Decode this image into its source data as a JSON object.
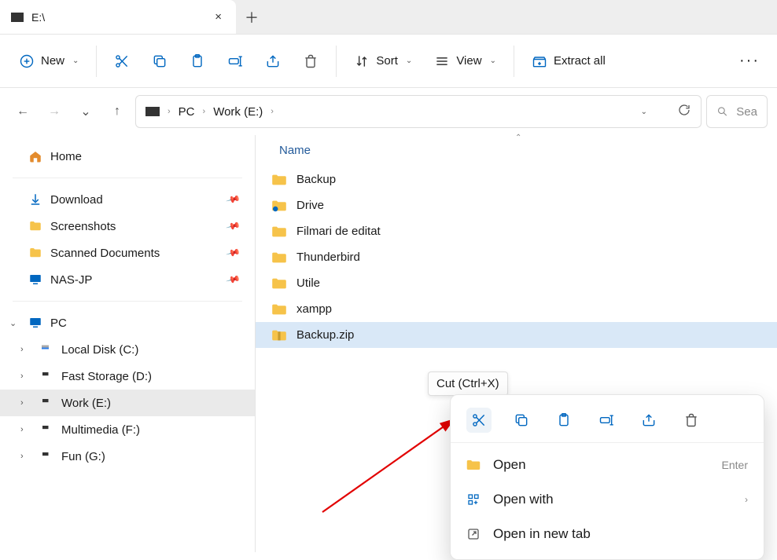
{
  "tab": {
    "title": "E:\\",
    "close": "×",
    "add": "＋"
  },
  "toolbar": {
    "new": "New",
    "sort": "Sort",
    "view": "View",
    "extract": "Extract all"
  },
  "breadcrumb": [
    "PC",
    "Work (E:)"
  ],
  "search": {
    "placeholder": "Sea"
  },
  "nav": {
    "home": "Home",
    "quick": [
      {
        "label": "Download",
        "icon": "download"
      },
      {
        "label": "Screenshots",
        "icon": "folder"
      },
      {
        "label": "Scanned Documents",
        "icon": "folder"
      },
      {
        "label": "NAS-JP",
        "icon": "monitor"
      }
    ],
    "pc": {
      "label": "PC",
      "drives": [
        "Local Disk (C:)",
        "Fast Storage (D:)",
        "Work (E:)",
        "Multimedia (F:)",
        "Fun (G:)"
      ]
    }
  },
  "fileheader": {
    "name": "Name"
  },
  "files": [
    {
      "name": "Backup",
      "type": "folder"
    },
    {
      "name": "Drive",
      "type": "drive"
    },
    {
      "name": "Filmari de editat",
      "type": "folder"
    },
    {
      "name": "Thunderbird",
      "type": "folder"
    },
    {
      "name": "Utile",
      "type": "folder"
    },
    {
      "name": "xampp",
      "type": "folder"
    },
    {
      "name": "Backup.zip",
      "type": "zip",
      "selected": true
    }
  ],
  "tooltip": "Cut (Ctrl+X)",
  "context": {
    "open": "Open",
    "open_hint": "Enter",
    "openwith": "Open with",
    "newtab": "Open in new tab"
  }
}
